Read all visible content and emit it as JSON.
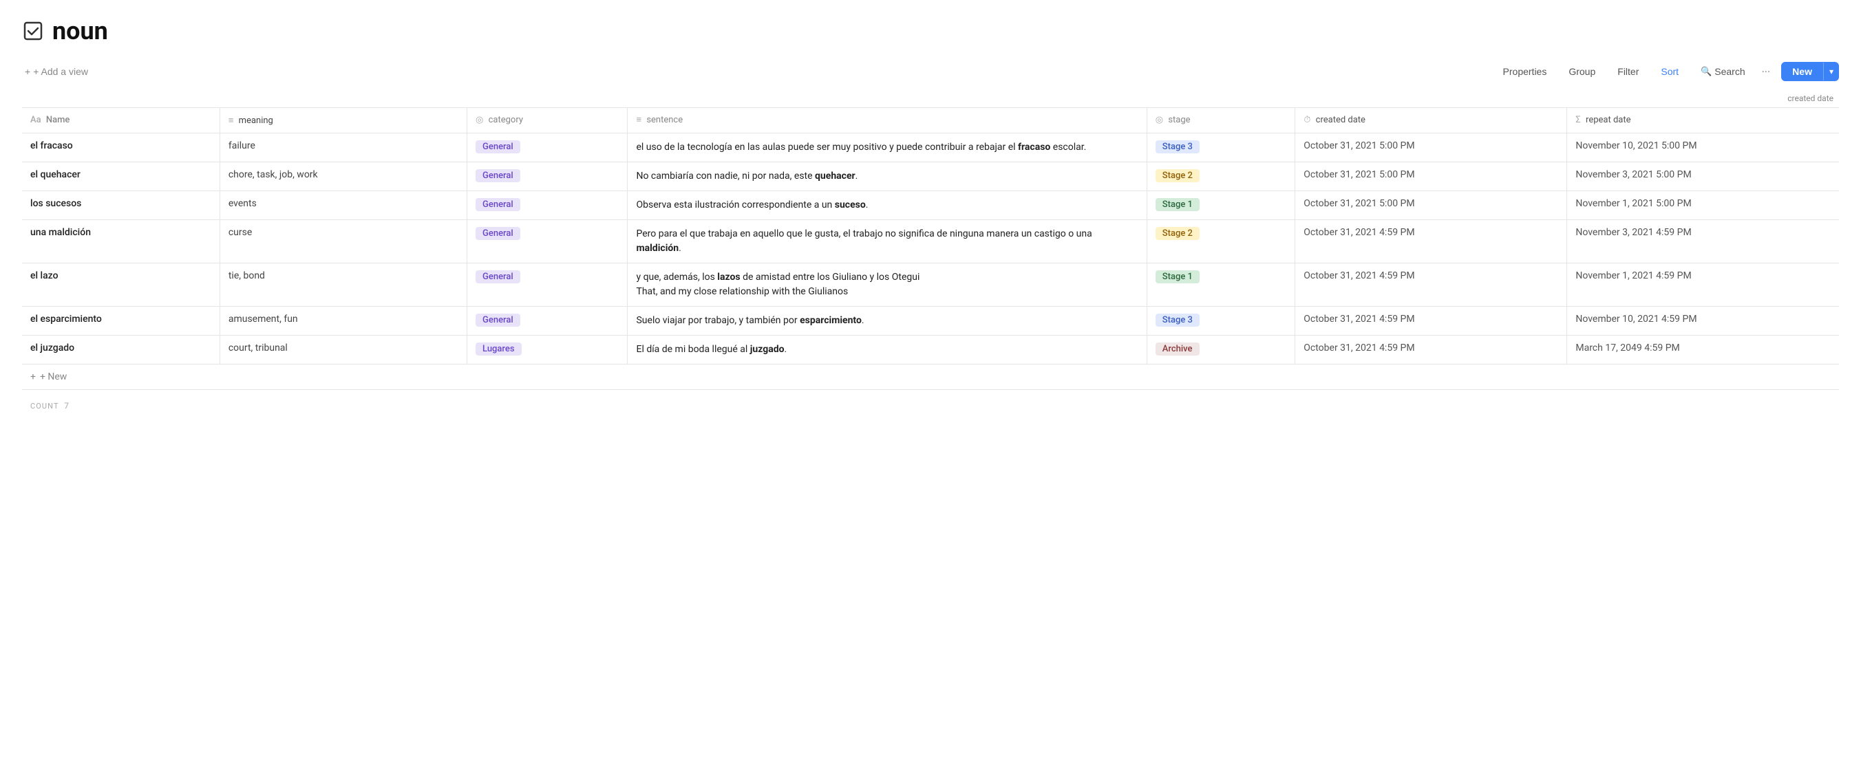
{
  "page": {
    "title": "noun",
    "checkbox_icon": "☑"
  },
  "toolbar": {
    "add_view_label": "+ Add a view",
    "properties_label": "Properties",
    "group_label": "Group",
    "filter_label": "Filter",
    "sort_label": "Sort",
    "search_label": "Search",
    "more_label": "···",
    "new_label": "New",
    "chevron_label": "▾"
  },
  "sort_indicator": "created date",
  "columns": [
    {
      "key": "name",
      "label": "Name",
      "icon": "Aa"
    },
    {
      "key": "meaning",
      "label": "meaning",
      "icon": "≡"
    },
    {
      "key": "category",
      "label": "category",
      "icon": "◎"
    },
    {
      "key": "sentence",
      "label": "sentence",
      "icon": "≡"
    },
    {
      "key": "stage",
      "label": "stage",
      "icon": "◎"
    },
    {
      "key": "created_date",
      "label": "created date",
      "icon": "⏱"
    },
    {
      "key": "repeat_date",
      "label": "repeat date",
      "icon": "Σ"
    }
  ],
  "rows": [
    {
      "name": "el fracaso",
      "meaning": "failure",
      "category": "General",
      "category_class": "badge-general",
      "sentence_parts": [
        {
          "text": "el uso de la tecnología en las aulas puede ser muy positivo y puede contribuir a rebajar el ",
          "bold": false
        },
        {
          "text": "fracaso",
          "bold": true
        },
        {
          "text": " escolar.",
          "bold": false
        }
      ],
      "stage": "Stage 3",
      "stage_class": "badge-stage3",
      "created_date": "October 31, 2021 5:00 PM",
      "repeat_date": "November 10, 2021 5:00 PM"
    },
    {
      "name": "el quehacer",
      "meaning": "chore, task, job, work",
      "category": "General",
      "category_class": "badge-general",
      "sentence_parts": [
        {
          "text": "No cambiaría con nadie, ni por nada, este ",
          "bold": false
        },
        {
          "text": "quehacer",
          "bold": true
        },
        {
          "text": ".",
          "bold": false
        }
      ],
      "stage": "Stage 2",
      "stage_class": "badge-stage2",
      "created_date": "October 31, 2021 5:00 PM",
      "repeat_date": "November 3, 2021 5:00 PM"
    },
    {
      "name": "los sucesos",
      "meaning": "events",
      "category": "General",
      "category_class": "badge-general",
      "sentence_parts": [
        {
          "text": "Observa esta ilustración correspondiente a un ",
          "bold": false
        },
        {
          "text": "suceso",
          "bold": true
        },
        {
          "text": ".",
          "bold": false
        }
      ],
      "stage": "Stage 1",
      "stage_class": "badge-stage1",
      "created_date": "October 31, 2021 5:00 PM",
      "repeat_date": "November 1, 2021 5:00 PM"
    },
    {
      "name": "una maldición",
      "meaning": "curse",
      "category": "General",
      "category_class": "badge-general",
      "sentence_parts": [
        {
          "text": "Pero para el que trabaja en aquello que le gusta, el trabajo no significa de ninguna manera un castigo o una ",
          "bold": false
        },
        {
          "text": "maldición",
          "bold": true
        },
        {
          "text": ".",
          "bold": false
        }
      ],
      "stage": "Stage 2",
      "stage_class": "badge-stage2",
      "created_date": "October 31, 2021 4:59 PM",
      "repeat_date": "November 3, 2021 4:59 PM"
    },
    {
      "name": "el lazo",
      "meaning": "tie, bond",
      "category": "General",
      "category_class": "badge-general",
      "sentence_parts": [
        {
          "text": "y que, además, los ",
          "bold": false
        },
        {
          "text": "lazos",
          "bold": true
        },
        {
          "text": " de amistad entre los Giuliano y los Otegui\nThat, and my close relationship with the Giulianos",
          "bold": false
        }
      ],
      "stage": "Stage 1",
      "stage_class": "badge-stage1",
      "created_date": "October 31, 2021 4:59 PM",
      "repeat_date": "November 1, 2021 4:59 PM"
    },
    {
      "name": "el esparcimiento",
      "meaning": "amusement, fun",
      "category": "General",
      "category_class": "badge-general",
      "sentence_parts": [
        {
          "text": "Suelo viajar por trabajo, y también por ",
          "bold": false
        },
        {
          "text": "esparcimiento",
          "bold": true
        },
        {
          "text": ".",
          "bold": false
        }
      ],
      "stage": "Stage 3",
      "stage_class": "badge-stage3",
      "created_date": "October 31, 2021 4:59 PM",
      "repeat_date": "November 10, 2021 4:59 PM"
    },
    {
      "name": "el juzgado",
      "meaning": "court, tribunal",
      "category": "Lugares",
      "category_class": "badge-lugares",
      "sentence_parts": [
        {
          "text": "El día de mi boda llegué al ",
          "bold": false
        },
        {
          "text": "juzgado",
          "bold": true
        },
        {
          "text": ".",
          "bold": false
        }
      ],
      "stage": "Archive",
      "stage_class": "badge-archive",
      "created_date": "October 31, 2021 4:59 PM",
      "repeat_date": "March 17, 2049 4:59 PM"
    }
  ],
  "footer": {
    "add_new_label": "+ New",
    "count_label": "COUNT",
    "count_value": "7"
  }
}
